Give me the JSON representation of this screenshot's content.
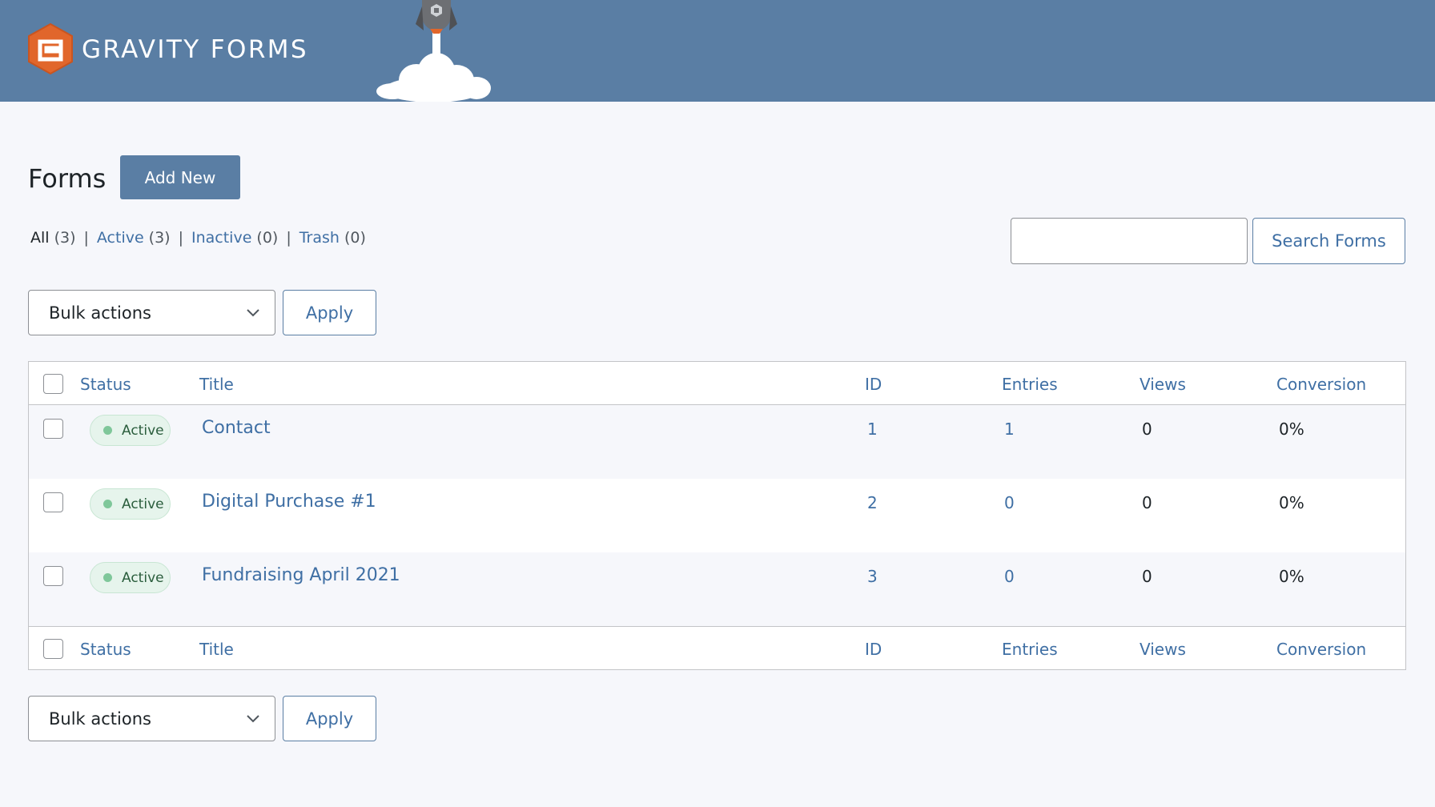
{
  "header": {
    "brand": "GRAVITY FORMS",
    "colors": {
      "banner": "#5a7ea4",
      "logo_orange": "#e1662b"
    }
  },
  "page": {
    "title": "Forms",
    "add_new_label": "Add New"
  },
  "filters": [
    {
      "label": "All",
      "count": "(3)",
      "current": true
    },
    {
      "label": "Active",
      "count": "(3)",
      "current": false
    },
    {
      "label": "Inactive",
      "count": "(0)",
      "current": false
    },
    {
      "label": "Trash",
      "count": "(0)",
      "current": false
    }
  ],
  "search": {
    "value": "",
    "button_label": "Search Forms"
  },
  "bulk_top": {
    "selected": "Bulk actions",
    "apply_label": "Apply"
  },
  "bulk_bottom": {
    "selected": "Bulk actions",
    "apply_label": "Apply"
  },
  "table": {
    "columns": {
      "status": "Status",
      "title": "Title",
      "id": "ID",
      "entries": "Entries",
      "views": "Views",
      "conversion": "Conversion"
    },
    "rows": [
      {
        "status": "Active",
        "title": "Contact",
        "id": "1",
        "entries": "1",
        "views": "0",
        "conversion": "0%"
      },
      {
        "status": "Active",
        "title": "Digital Purchase #1",
        "id": "2",
        "entries": "0",
        "views": "0",
        "conversion": "0%"
      },
      {
        "status": "Active",
        "title": "Fundraising April 2021",
        "id": "3",
        "entries": "0",
        "views": "0",
        "conversion": "0%"
      }
    ]
  }
}
